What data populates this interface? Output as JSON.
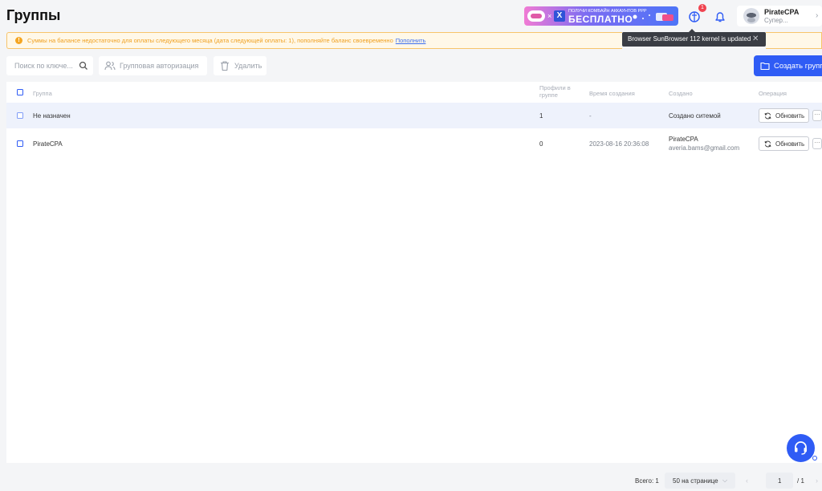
{
  "page": {
    "title": "Группы"
  },
  "promo": {
    "small_text": "ПОЛУЧИ КОМБАЙН АККАУНТОВ PPP",
    "big_text": "БЕСПЛАТНО",
    "box_letter": "X"
  },
  "notifications": {
    "count": "1"
  },
  "user": {
    "name": "PirateCPA",
    "role": "Супер..."
  },
  "tooltip": {
    "text": "Browser SunBrowser 112 kernel is updated"
  },
  "alert": {
    "text": "Суммы на балансе недостаточно для оплаты следующего месяца (дата следующей оплаты: 1), пополняйте баланс своевременно",
    "link": "Пополнить"
  },
  "toolbar": {
    "search_placeholder": "Поиск по ключе...",
    "group_auth": "Групповая авторизация",
    "delete": "Удалить",
    "create": "Создать групп"
  },
  "table": {
    "headers": {
      "group": "Группа",
      "profiles_line1": "Профили в",
      "profiles_line2": "группе",
      "created_time": "Время создания",
      "created_by": "Создано",
      "operation": "Операция"
    },
    "rows": [
      {
        "group": "Не назначен",
        "profiles": "1",
        "time": "-",
        "created_by": "Создано ситемой",
        "created_by_email": "",
        "action": "Обновить"
      },
      {
        "group": "PirateCPA",
        "profiles": "0",
        "time": "2023-08-16 20:36:08",
        "created_by": "PirateCPA",
        "created_by_email": "averia.bams@gmail.com",
        "action": "Обновить"
      }
    ]
  },
  "pagination": {
    "total": "Всего: 1",
    "per_page": "50 на странице",
    "current": "1",
    "pages": "/ 1"
  },
  "colors": {
    "accent": "#2f5cf5",
    "warning": "#f5a623",
    "danger": "#f0434f"
  },
  "icons": [
    "promo-banner-icon",
    "translate-icon",
    "bell-icon",
    "avatar-icon",
    "close-icon",
    "warning-icon",
    "search-icon",
    "users-icon",
    "trash-icon",
    "folder-icon",
    "refresh-icon",
    "more-icon",
    "headset-icon",
    "chevron-left-icon",
    "chevron-right-icon",
    "chevron-down-icon"
  ]
}
